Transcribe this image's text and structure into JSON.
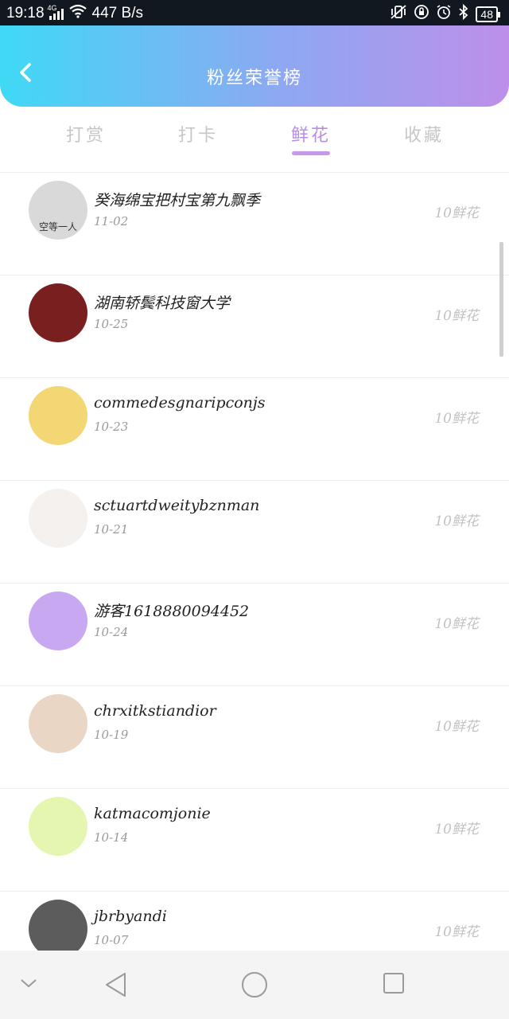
{
  "status_bar": {
    "time": "19:18",
    "network": "4G",
    "speed": "447 B/s",
    "battery": "48",
    "icons": [
      "signal-icon",
      "wifi-icon",
      "vibrate-icon",
      "dnd-icon",
      "alarm-icon",
      "bluetooth-icon",
      "battery-icon"
    ]
  },
  "header": {
    "title": "粉丝荣誉榜",
    "gradient": [
      "#3fd9f5",
      "#bd8fea"
    ]
  },
  "tabs": [
    "打赏",
    "打卡",
    "鲜花",
    "收藏"
  ],
  "active_tab": "鲜花",
  "accent_color": "#b78de6",
  "list": [
    {
      "name": "癸海绵宝把村宝第九飘季",
      "date": "11-02",
      "count": "10鲜花",
      "avatar_color": "#d9d9d9",
      "avatar_caption": "空等一人"
    },
    {
      "name": "湖南轿鬓科技窗大学",
      "date": "10-25",
      "count": "10鲜花",
      "avatar_color": "#7a1f1f",
      "avatar_caption": ""
    },
    {
      "name": "commedesgnaripconjs",
      "date": "10-23",
      "count": "10鲜花",
      "avatar_color": "#f3d775",
      "avatar_caption": ""
    },
    {
      "name": "sctuartdweitybznman",
      "date": "10-21",
      "count": "10鲜花",
      "avatar_color": "#f4f1ee",
      "avatar_caption": ""
    },
    {
      "name": "游客1618880094452",
      "date": "10-24",
      "count": "10鲜花",
      "avatar_color": "#c8a9f1",
      "avatar_caption": ""
    },
    {
      "name": "chrxitkstiandior",
      "date": "10-19",
      "count": "10鲜花",
      "avatar_color": "#ead6c5",
      "avatar_caption": ""
    },
    {
      "name": "katmacomjonie",
      "date": "10-14",
      "count": "10鲜花",
      "avatar_color": "#e4f6b0",
      "avatar_caption": ""
    },
    {
      "name": "jbrbyandi",
      "date": "10-07",
      "count": "10鲜花",
      "avatar_color": "#5c5c5c",
      "avatar_caption": ""
    }
  ],
  "nav_bar": {
    "icons": [
      "chevron-down-icon",
      "back-triangle-icon",
      "home-circle-icon",
      "recents-square-icon"
    ]
  }
}
